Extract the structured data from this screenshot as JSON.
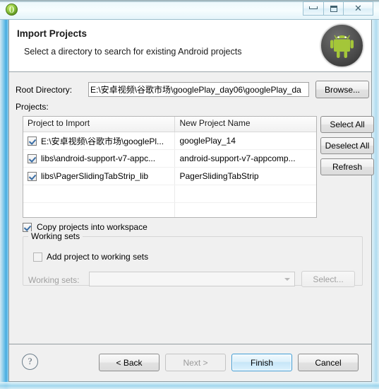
{
  "window": {
    "app_icon": "eclipse-orb-icon",
    "controls": {
      "minimize": "minimize-icon",
      "maximize": "maximize-icon",
      "close": "close-icon"
    }
  },
  "header": {
    "title": "Import Projects",
    "subtitle": "Select a directory to search for existing Android projects",
    "logo": "android-robot-icon"
  },
  "root": {
    "label": "Root Directory:",
    "value": "E:\\安卓视频\\谷歌市场\\googlePlay_day06\\googlePlay_da",
    "placeholder": "",
    "browse_label": "Browse..."
  },
  "projects": {
    "label": "Projects:",
    "columns": [
      "Project to Import",
      "New Project Name"
    ],
    "rows": [
      {
        "checked": true,
        "project": "E:\\安卓视频\\谷歌市场\\googlePl...",
        "name": "googlePlay_14"
      },
      {
        "checked": true,
        "project": "libs\\android-support-v7-appc...",
        "name": "android-support-v7-appcomp..."
      },
      {
        "checked": true,
        "project": "libs\\PagerSlidingTabStrip_lib",
        "name": "PagerSlidingTabStrip"
      },
      {
        "checked": null,
        "project": "",
        "name": ""
      },
      {
        "checked": null,
        "project": "",
        "name": ""
      }
    ],
    "side_buttons": [
      "Select All",
      "Deselect All",
      "Refresh"
    ]
  },
  "copy_option": {
    "label": "Copy projects into workspace",
    "checked": true
  },
  "working_sets": {
    "legend": "Working sets",
    "add_label": "Add project to working sets",
    "add_checked": false,
    "select_label": "Working sets:",
    "combo_value": "",
    "select_button": "Select..."
  },
  "footer": {
    "help": "?",
    "back": "< Back",
    "next": "Next >",
    "finish": "Finish",
    "cancel": "Cancel"
  },
  "colors": {
    "accent": "#3c9bd4",
    "dialog_bg": "#f0f0f0",
    "android_green": "#a4c639"
  }
}
